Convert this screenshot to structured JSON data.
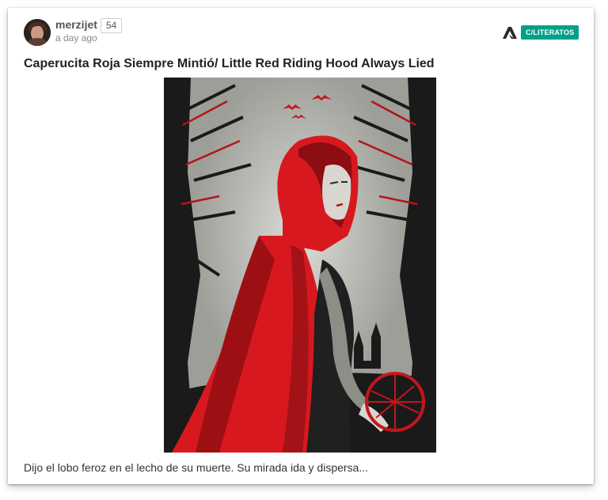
{
  "post": {
    "author": {
      "name": "merzijet",
      "karma": "54"
    },
    "timestamp": "a day ago",
    "community": "C/LITERATOS",
    "title": "Caperucita Roja Siempre Mintió/ Little Red Riding Hood Always Lied",
    "excerpt": "Dijo el lobo feroz en el lecho de su muerte. Su mirada ida y dispersa...",
    "image": {
      "subject": "illustration of Little Red Riding Hood in a red cloak",
      "accent": "#d7191f"
    }
  },
  "colors": {
    "tag_bg": "#00a08a",
    "title": "#222222",
    "meta": "#8a8a8a"
  },
  "icons": {
    "community_logo": "community-logo-icon"
  }
}
